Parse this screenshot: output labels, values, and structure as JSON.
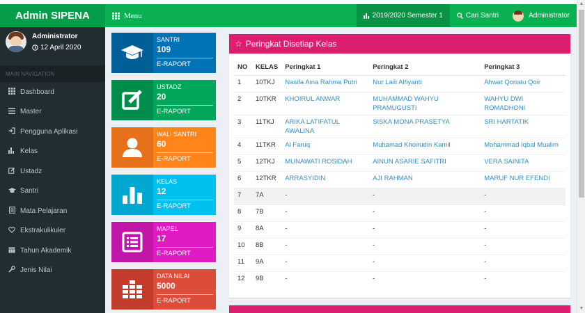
{
  "header": {
    "brand": "Admin SIPENA",
    "menu_label": "Menu",
    "semester": "2019/2020 Semester 1",
    "search_label": "Cari Santri",
    "user_label": "Administrator"
  },
  "sidebar": {
    "user_name": "Administrator",
    "user_date": "12 April 2020",
    "section_label": "MAIN NAVIGATION",
    "items": [
      {
        "label": "Dashboard",
        "icon": "th-icon"
      },
      {
        "label": "Master",
        "icon": "bars-icon"
      },
      {
        "label": "Pengguna Aplikasi",
        "icon": "sign-in-icon"
      },
      {
        "label": "Kelas",
        "icon": "bar-chart-icon"
      },
      {
        "label": "Ustadz",
        "icon": "edit-icon"
      },
      {
        "label": "Santri",
        "icon": "graduation-cap-icon"
      },
      {
        "label": "Mata Pelajaran",
        "icon": "book-icon"
      },
      {
        "label": "Ekstrakulikuler",
        "icon": "heart-icon"
      },
      {
        "label": "Tahun Akademik",
        "icon": "calendar-icon"
      },
      {
        "label": "Jenis Nilai",
        "icon": "wrench-icon"
      }
    ]
  },
  "info_boxes": [
    {
      "title": "SANTRI",
      "number": "109",
      "footer": "E-RAPORT",
      "color": "#0073b7",
      "icon_color": "#005f96",
      "icon": "graduation-cap-icon"
    },
    {
      "title": "USTADZ",
      "number": "20",
      "footer": "E-RAPORT",
      "color": "#00a65a",
      "icon_color": "#008d4c",
      "icon": "edit-icon"
    },
    {
      "title": "WALI SANTRI",
      "number": "60",
      "footer": "E-RAPORT",
      "color": "#ff851b",
      "icon_color": "#e6711a",
      "icon": "user-icon"
    },
    {
      "title": "KELAS",
      "number": "12",
      "footer": "E-RAPORT",
      "color": "#00c0ef",
      "icon_color": "#00a7d0",
      "icon": "bar-chart-icon"
    },
    {
      "title": "MAPEL",
      "number": "17",
      "footer": "E-RAPORT",
      "color": "#e01bc3",
      "icon_color": "#c017a8",
      "icon": "list-alt-icon"
    },
    {
      "title": "DATA NILAI",
      "number": "5000",
      "footer": "E-RAPORT",
      "color": "#dd4b39",
      "icon_color": "#c23b2b",
      "icon": "grid-icon"
    }
  ],
  "ranking": {
    "title": "Peringkat Disetiap Kelas",
    "columns": [
      "NO",
      "KELAS",
      "Peringkat 1",
      "Peringkat 2",
      "Peringkat 3"
    ],
    "rows": [
      {
        "no": "1",
        "kelas": "10TKJ",
        "p1": "Nasifa Aina Rahma Putri",
        "p2": "Nur Laili Alfiyanti",
        "p3": "Ahwat Qoriatu Qoir"
      },
      {
        "no": "2",
        "kelas": "10TKR",
        "p1": "KHOIRUL ANWAR",
        "p2": "MUHAMMAD WAHYU PRAMUGUSTI",
        "p3": "WAHYU DWI ROMADHONI"
      },
      {
        "no": "3",
        "kelas": "11TKJ",
        "p1": "ARIKA LATIFATUL AWALINA",
        "p2": "SISKA MONA PRASETYA",
        "p3": "SRI HARTATIK"
      },
      {
        "no": "4",
        "kelas": "11TKR",
        "p1": "Al Faruq",
        "p2": "Muhamad Khoirudin Kamil",
        "p3": "Mohammad Iqbal Mualim"
      },
      {
        "no": "5",
        "kelas": "12TKJ",
        "p1": "MUNAWATI ROSIDAH",
        "p2": "AINUN ASARIE SAFITRI",
        "p3": "VERA SAINITA"
      },
      {
        "no": "6",
        "kelas": "12TKR",
        "p1": "ARRASYIDIN",
        "p2": "AJI RAHMAN",
        "p3": "MARUF NUR EFENDI"
      },
      {
        "no": "7",
        "kelas": "7A",
        "p1": "-",
        "p2": "-",
        "p3": "-"
      },
      {
        "no": "8",
        "kelas": "7B",
        "p1": "-",
        "p2": "-",
        "p3": "-"
      },
      {
        "no": "9",
        "kelas": "8A",
        "p1": "-",
        "p2": "-",
        "p3": "-"
      },
      {
        "no": "10",
        "kelas": "8B",
        "p1": "-",
        "p2": "-",
        "p3": "-"
      },
      {
        "no": "11",
        "kelas": "9A",
        "p1": "-",
        "p2": "-",
        "p3": "-"
      },
      {
        "no": "12",
        "kelas": "9B",
        "p1": "-",
        "p2": "-",
        "p3": "-"
      }
    ]
  }
}
